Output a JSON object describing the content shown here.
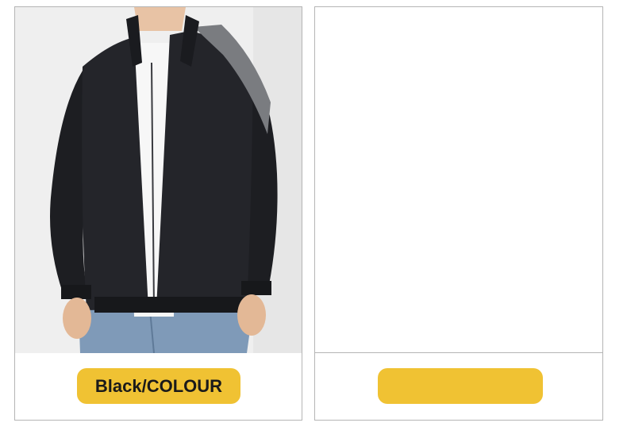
{
  "options": [
    {
      "label": "Black/COLOUR",
      "photo": "black-jacket-with-grey-shoulder-panel-photo",
      "colors": {
        "jacket": "#1d1e22",
        "panel": "#7a7c80",
        "background": "#efefef",
        "shirt": "#f7f7f7",
        "jeans": "#7f9ab8"
      }
    },
    {
      "label": "",
      "photo": "blank-white-image"
    }
  ],
  "accent_color": "#f0c233"
}
